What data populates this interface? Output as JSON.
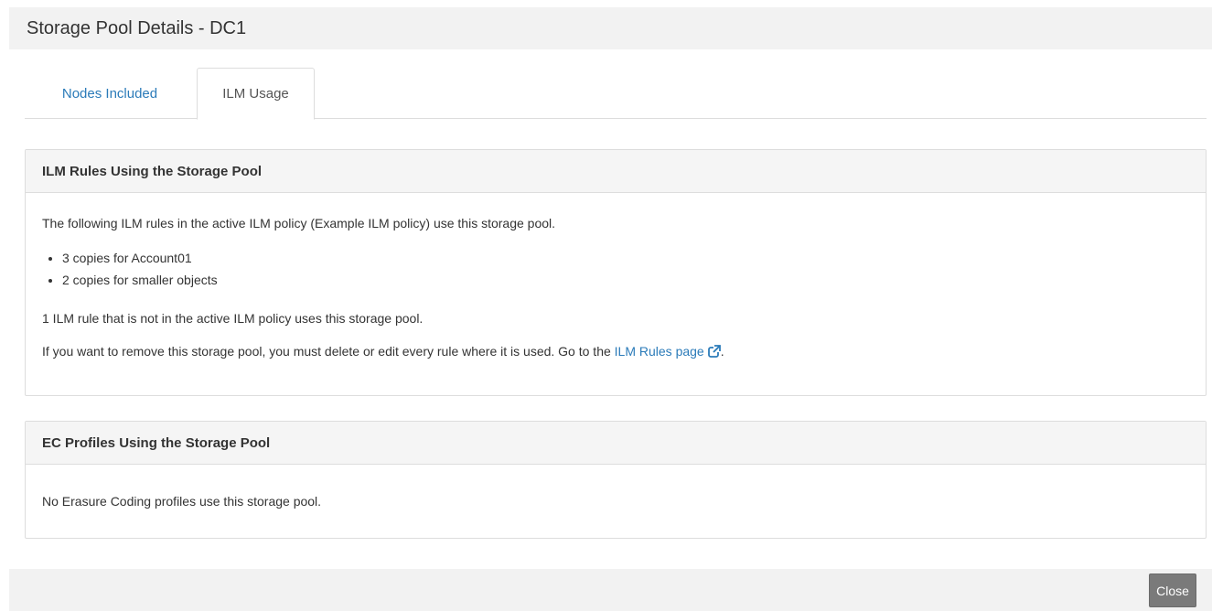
{
  "header": {
    "title": "Storage Pool Details - DC1"
  },
  "tabs": [
    {
      "label": "Nodes Included",
      "active": false
    },
    {
      "label": "ILM Usage",
      "active": true
    }
  ],
  "ilm_rules_panel": {
    "heading": "ILM Rules Using the Storage Pool",
    "intro": "The following ILM rules in the active ILM policy (Example ILM policy) use this storage pool.",
    "rules": [
      "3 copies for Account01",
      "2 copies for smaller objects"
    ],
    "inactive_note": "1 ILM rule that is not in the active ILM policy uses this storage pool.",
    "remove_note_prefix": "If you want to remove this storage pool, you must delete or edit every rule where it is used. Go to the",
    "link_label": "ILM Rules page",
    "remove_note_suffix": "."
  },
  "ec_profiles_panel": {
    "heading": "EC Profiles Using the Storage Pool",
    "body": "No Erasure Coding profiles use this storage pool."
  },
  "footer": {
    "close_label": "Close"
  },
  "colors": {
    "link": "#2b7bb9",
    "header_bg": "#f2f2f2",
    "panel_heading_bg": "#f5f5f5",
    "close_button_bg": "#7a7a7a"
  },
  "icons": {
    "external_link": "external-link-icon"
  }
}
